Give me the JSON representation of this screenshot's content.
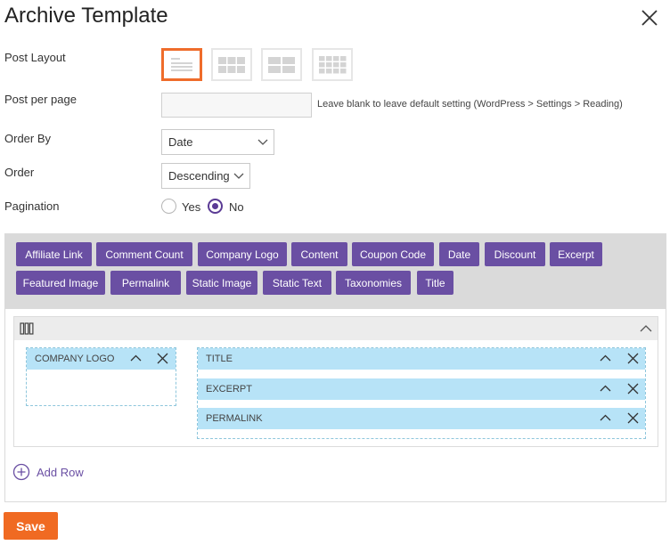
{
  "dialog": {
    "title": "Archive Template"
  },
  "form": {
    "post_layout_label": "Post Layout",
    "layout_options": [
      {
        "name": "list",
        "selected": true
      },
      {
        "name": "grid-2x3",
        "selected": false
      },
      {
        "name": "grid-2x2",
        "selected": false
      },
      {
        "name": "grid-3x4",
        "selected": false
      }
    ],
    "post_per_page_label": "Post per page",
    "post_per_page_value": "",
    "post_per_page_hint": "Leave blank to leave default setting (WordPress > Settings > Reading)",
    "order_by_label": "Order By",
    "order_by_value": "Date",
    "order_label": "Order",
    "order_value": "Descending",
    "pagination_label": "Pagination",
    "pagination_yes": "Yes",
    "pagination_no": "No",
    "pagination_selected": "No"
  },
  "fields": [
    "Affiliate Link",
    "Comment Count",
    "Company Logo",
    "Content",
    "Coupon Code",
    "Date",
    "Discount",
    "Excerpt",
    "Featured Image",
    "Permalink",
    "Static Image",
    "Static Text",
    "Taxonomies",
    "Title"
  ],
  "builder": {
    "left_column": [
      "Company Logo"
    ],
    "right_column": [
      "Title",
      "Excerpt",
      "Permalink"
    ],
    "add_row_label": "Add Row"
  },
  "footer": {
    "save_label": "Save"
  },
  "colors": {
    "accent": "#6a4fa3",
    "save": "#f06a22",
    "selected_border": "#ef6c2b",
    "item_bg": "#b7e3f7"
  }
}
